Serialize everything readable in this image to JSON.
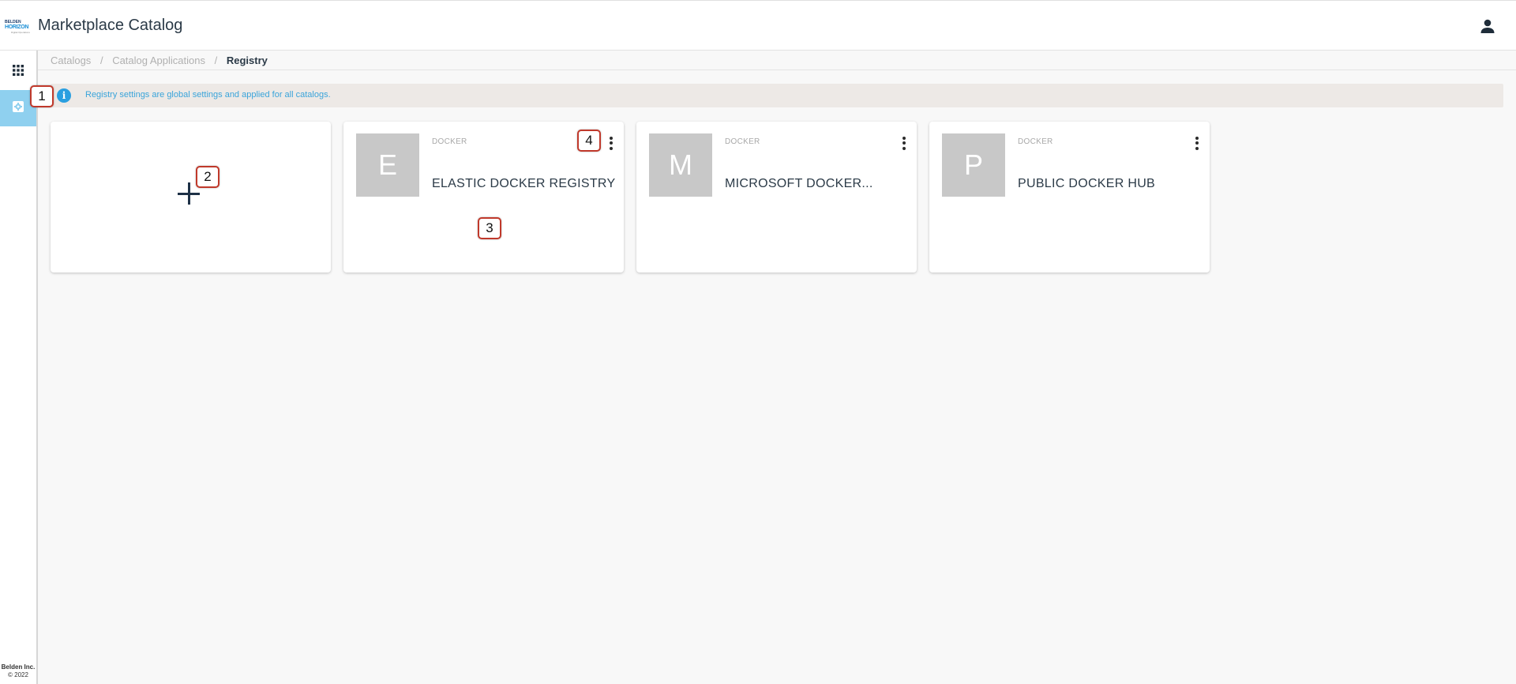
{
  "header": {
    "logo_top": "BELDEN",
    "logo_main": "HORIZON",
    "logo_sub": "Digital Operations",
    "title": "Marketplace Catalog",
    "user_icon": "user-icon"
  },
  "sidebar": {
    "items": [
      {
        "icon": "apps-grid-icon",
        "active": false
      },
      {
        "icon": "settings-gear-icon",
        "active": true
      }
    ],
    "footer_company": "Belden Inc.",
    "footer_copyright": "© 2022",
    "active_color": "#8fd0ef"
  },
  "breadcrumb": {
    "items": [
      "Catalogs",
      "Catalog Applications"
    ],
    "current": "Registry",
    "separator": "/"
  },
  "info_banner": {
    "icon": "info-icon",
    "icon_glyph": "i",
    "text": "Registry settings are global settings and applied for all catalogs.",
    "accent": "#2a9fe0"
  },
  "add_card": {
    "icon": "plus-icon"
  },
  "registries": [
    {
      "initial": "E",
      "type": "DOCKER",
      "name": "ELASTIC DOCKER REGISTRY"
    },
    {
      "initial": "M",
      "type": "DOCKER",
      "name": "MICROSOFT DOCKER..."
    },
    {
      "initial": "P",
      "type": "DOCKER",
      "name": "PUBLIC DOCKER HUB"
    }
  ],
  "callouts": [
    "1",
    "2",
    "3",
    "4"
  ]
}
